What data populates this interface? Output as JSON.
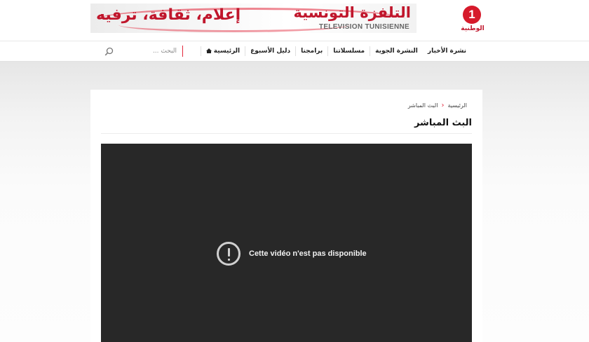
{
  "header": {
    "banner": {
      "slogan": "إعلام، ثقافة، ترفيه",
      "title_ar": "التلفزة التونسية",
      "title_fr": "TELEVISION TUNISIENNE"
    },
    "logo": {
      "mark": "1",
      "label": "الوطنية"
    }
  },
  "nav": {
    "items": [
      {
        "label": "الرئيسية",
        "icon": "home-icon"
      },
      {
        "label": "دليل الأسبوع"
      },
      {
        "label": "برامجنا"
      },
      {
        "label": "مسلسلاتنا"
      },
      {
        "label": "النشرة الجوية"
      },
      {
        "label": "نشرة الأخبار"
      }
    ],
    "search_placeholder": "البحث ..."
  },
  "breadcrumb": {
    "home": "الرئيسية",
    "separator": "‹",
    "current": "البث المباشر"
  },
  "page_title": "البث المباشر",
  "video": {
    "message": "Cette vidéo n'est pas disponible",
    "icon": "alert-circle-icon"
  },
  "colors": {
    "accent": "#e3263a",
    "brand_red": "#d61a2b",
    "player_bg": "#282828"
  }
}
